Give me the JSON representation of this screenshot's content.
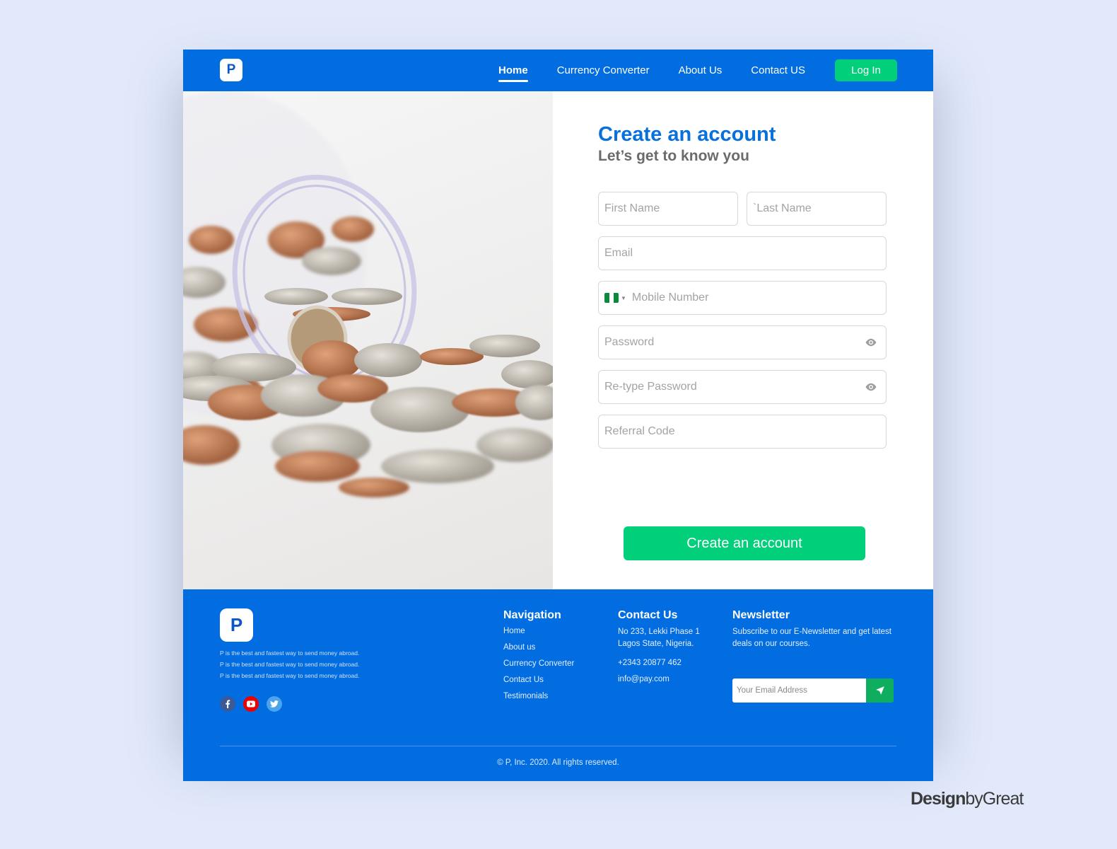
{
  "header": {
    "logo_letter": "P",
    "nav": [
      {
        "label": "Home",
        "active": true
      },
      {
        "label": "Currency Converter",
        "active": false
      },
      {
        "label": "About Us",
        "active": false
      },
      {
        "label": "Contact US",
        "active": false
      }
    ],
    "login_label": "Log In"
  },
  "hero": {
    "image": "coins-spilling-from-jar"
  },
  "form": {
    "title": "Create an account",
    "subtitle": "Let’s get to know you",
    "fields": {
      "first_name": {
        "placeholder": "First Name",
        "value": ""
      },
      "last_name": {
        "placeholder": "`Last Name",
        "value": ""
      },
      "email": {
        "placeholder": "Email",
        "value": ""
      },
      "mobile": {
        "placeholder": "Mobile Number",
        "value": "",
        "country": "Nigeria",
        "flag_colors": [
          "#0a8a3a",
          "#ffffff",
          "#0a8a3a"
        ]
      },
      "password": {
        "placeholder": "Password",
        "value": ""
      },
      "retype_password": {
        "placeholder": "Re-type Password",
        "value": ""
      },
      "referral": {
        "placeholder": "Referral Code",
        "value": ""
      }
    },
    "submit_label": "Create an account"
  },
  "footer": {
    "logo_letter": "P",
    "tagline": [
      "P is the best and fastest way to send money abroad.",
      "P is the best and fastest way to send money abroad.",
      "P is the best and fastest way to send money abroad."
    ],
    "socials": [
      {
        "name": "facebook",
        "glyph": "f",
        "color": "#3a5a98"
      },
      {
        "name": "youtube",
        "glyph": "▶",
        "color": "#ee0000"
      },
      {
        "name": "twitter",
        "glyph": "t",
        "color": "#4aa3ec"
      }
    ],
    "navigation": {
      "heading": "Navigation",
      "links": [
        "Home",
        "About us",
        "Currency Converter",
        "Contact Us",
        "Testimonials"
      ]
    },
    "contact": {
      "heading": "Contact Us",
      "address_line1": "No 233, Lekki Phase 1",
      "address_line2": "Lagos State, Nigeria.",
      "phone": "+2343  20877 462",
      "email": "info@pay.com"
    },
    "newsletter": {
      "heading": "Newsletter",
      "text": "Subscribe  to our E-Newsletter and get latest deals on our courses.",
      "placeholder": "Your Email Address",
      "value": ""
    },
    "copyright": "© P, Inc. 2020. All rights reserved."
  },
  "credit": {
    "bold": "Design",
    "rest": "byGreat"
  },
  "colors": {
    "primary": "#016de0",
    "accent": "#02cf7a",
    "title": "#0870dd"
  }
}
